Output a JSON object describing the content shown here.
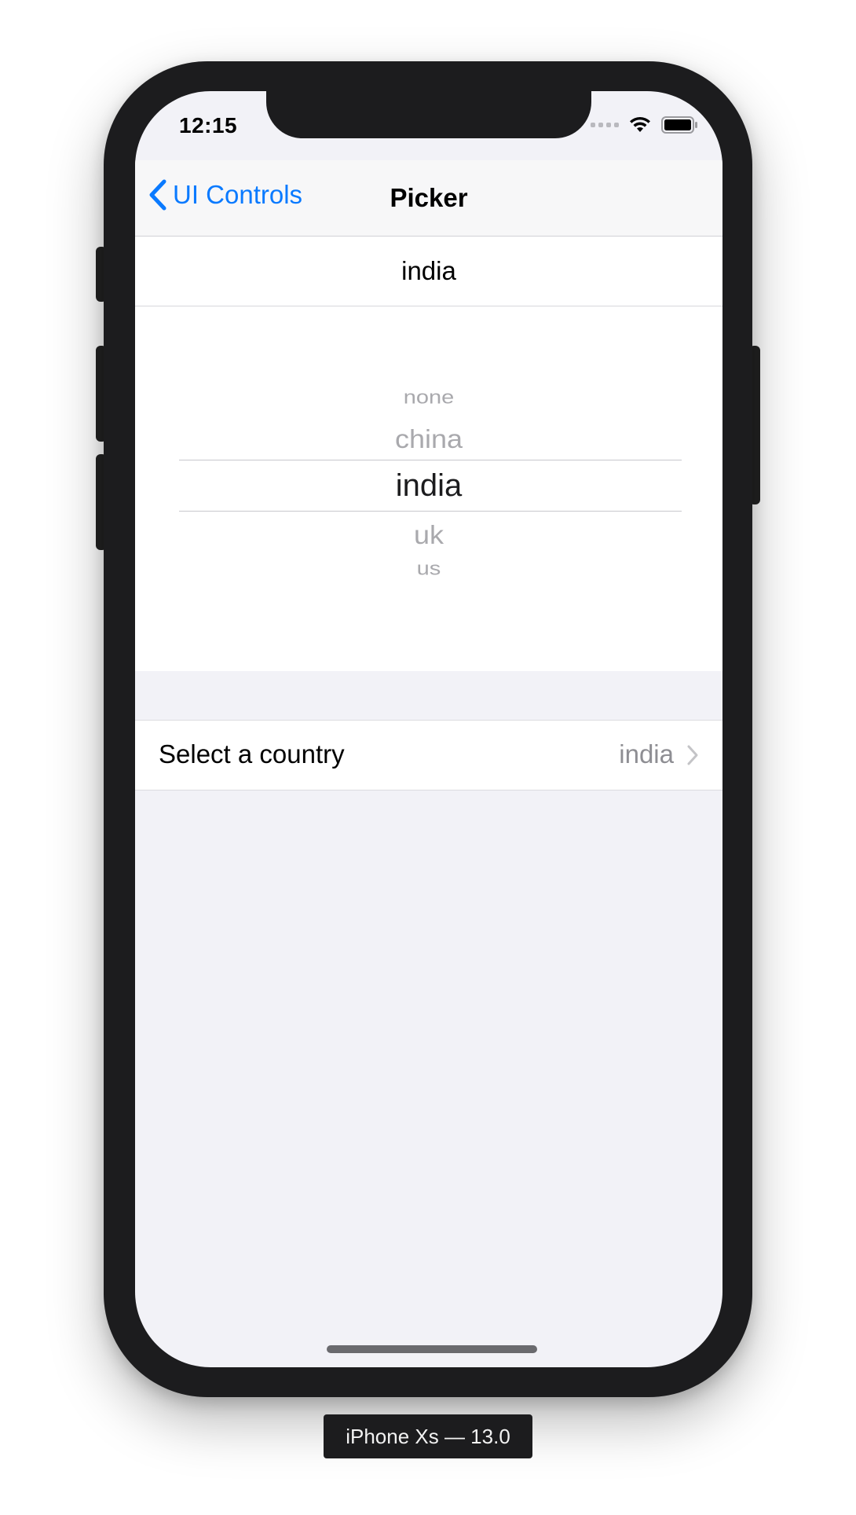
{
  "status_bar": {
    "time": "12:15",
    "icons": [
      "signal-icon",
      "wifi-icon",
      "battery-icon"
    ]
  },
  "nav": {
    "back_label": "UI Controls",
    "back_icon": "chevron-left-icon",
    "title": "Picker",
    "accent_color": "#0a7aff"
  },
  "selected_value_display": "india",
  "picker": {
    "options": [
      "none",
      "china",
      "india",
      "uk",
      "us"
    ],
    "selected": "india"
  },
  "country_row": {
    "label": "Select a country",
    "value": "india",
    "icon": "chevron-right-icon"
  },
  "device_label": "iPhone Xs — 13.0"
}
